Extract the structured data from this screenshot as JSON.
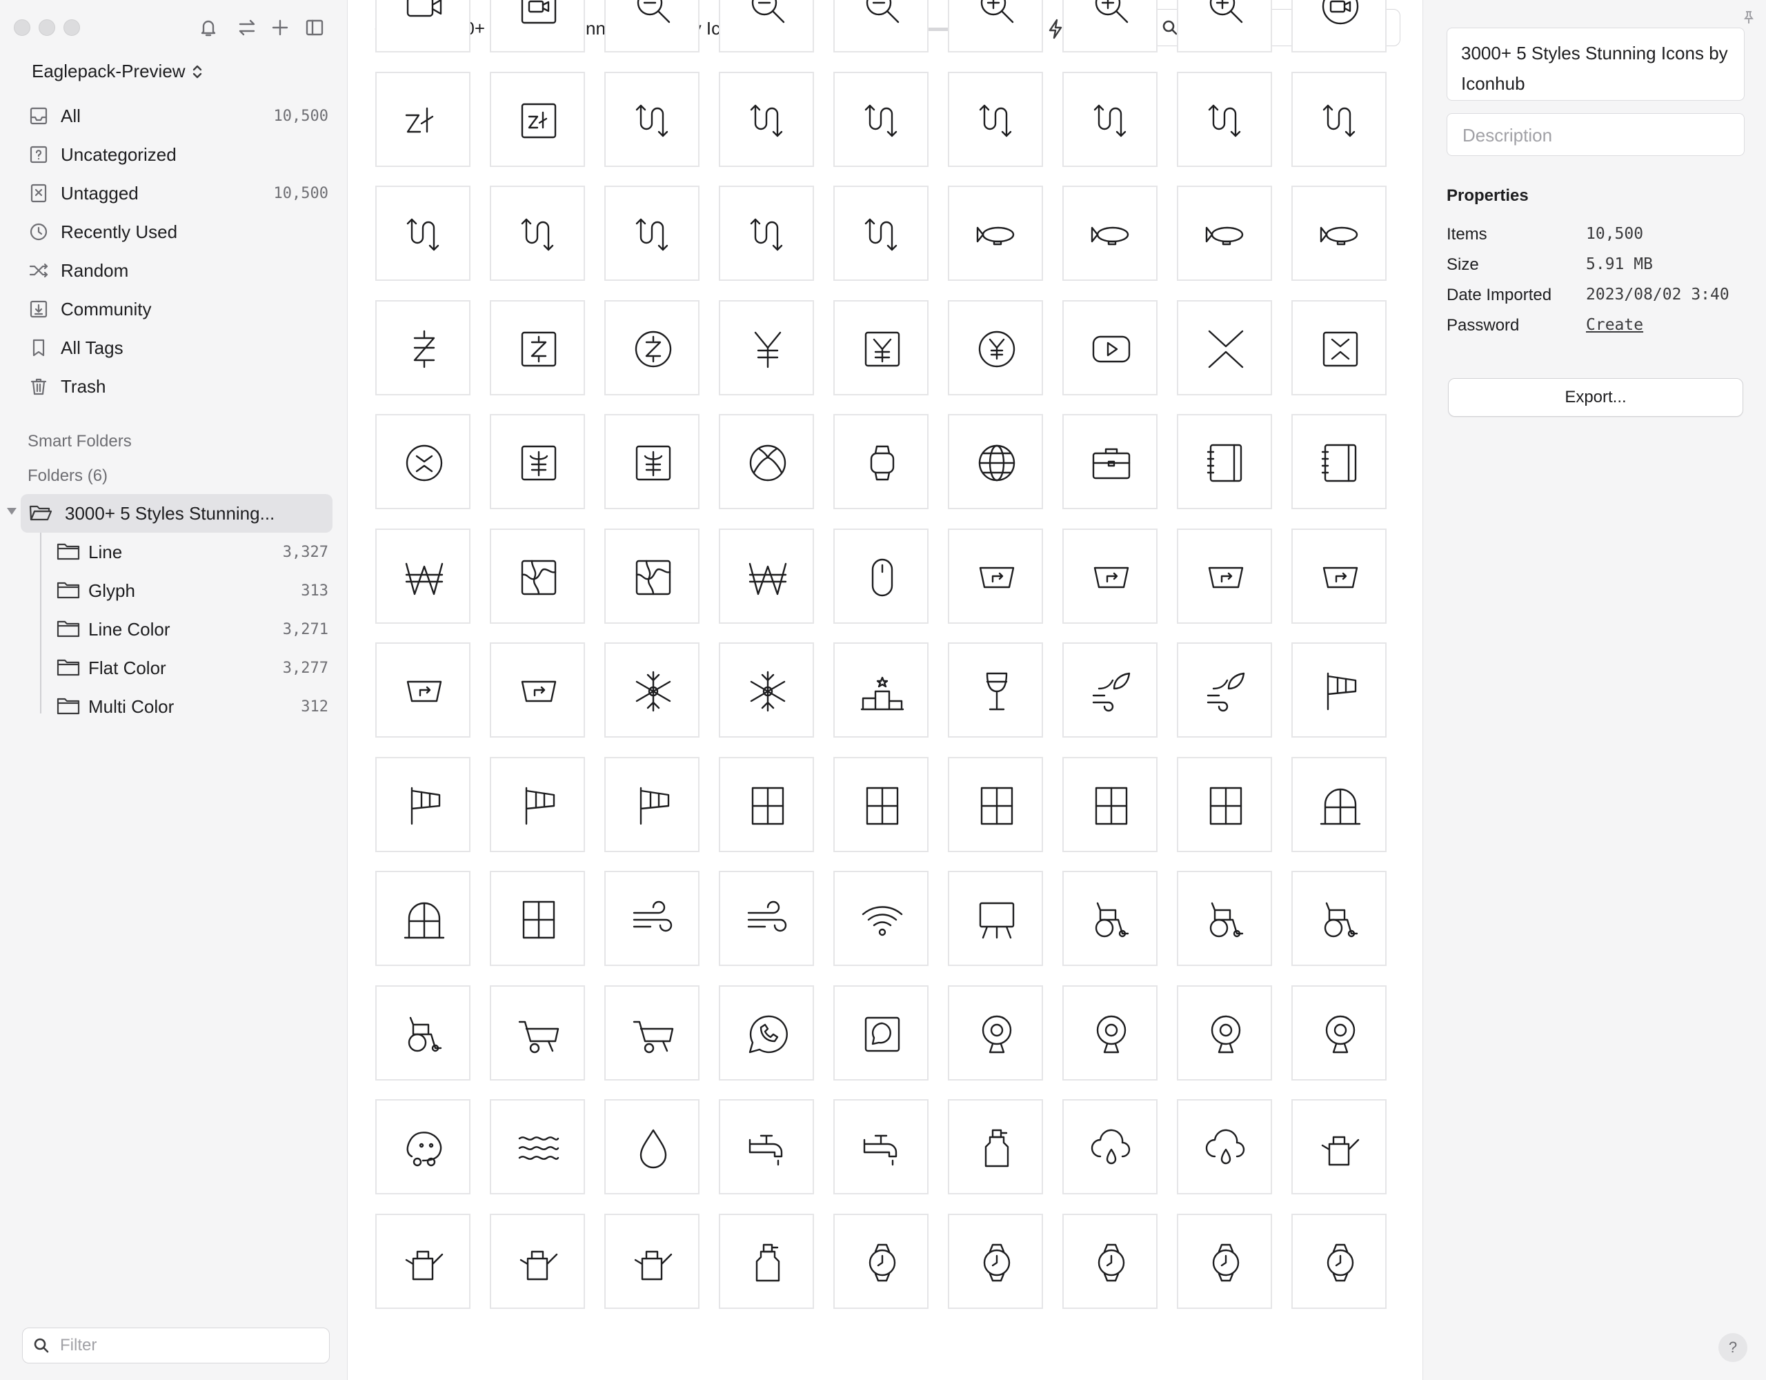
{
  "sidebar": {
    "library_name": "Eaglepack-Preview",
    "nav_items": [
      {
        "label": "All",
        "count": "10,500",
        "icon": "inbox-icon"
      },
      {
        "label": "Uncategorized",
        "count": "",
        "icon": "question-box-icon"
      },
      {
        "label": "Untagged",
        "count": "10,500",
        "icon": "untagged-icon"
      },
      {
        "label": "Recently Used",
        "count": "",
        "icon": "clock-icon"
      },
      {
        "label": "Random",
        "count": "",
        "icon": "shuffle-icon"
      },
      {
        "label": "Community",
        "count": "",
        "icon": "download-box-icon"
      },
      {
        "label": "All Tags",
        "count": "",
        "icon": "bookmark-icon"
      },
      {
        "label": "Trash",
        "count": "",
        "icon": "trash-icon"
      }
    ],
    "smart_folders_label": "Smart Folders",
    "folders_label": "Folders (6)",
    "root_folder": "3000+ 5 Styles Stunning...",
    "sub_folders": [
      {
        "label": "Line",
        "count": "3,327"
      },
      {
        "label": "Glyph",
        "count": "313"
      },
      {
        "label": "Line Color",
        "count": "3,271"
      },
      {
        "label": "Flat Color",
        "count": "3,277"
      },
      {
        "label": "Multi Color",
        "count": "312"
      }
    ],
    "filter_placeholder": "Filter"
  },
  "toolbar": {
    "title": "3000+ 5 Styles Stunning Icons by Iconhub",
    "search_placeholder": "Search",
    "zoom": 0
  },
  "grid": {
    "rows": [
      [
        "video-camera-icon",
        "video-box-icon",
        "zoom-out-icon",
        "zoom-out-icon",
        "zoom-out-icon",
        "zoom-in-icon",
        "zoom-in-icon",
        "zoom-in-icon",
        "video-circle-icon"
      ],
      [
        "zloty-icon",
        "zloty-box-icon",
        "zigzag-arrow-icon",
        "zigzag-arrow-icon",
        "zigzag-arrow-icon",
        "zigzag-arrow-icon",
        "zigzag-arrow-icon",
        "zigzag-arrow-icon",
        "zigzag-arrow-icon"
      ],
      [
        "zigzag-arrow-icon",
        "zigzag-arrow-icon",
        "zigzag-arrow-icon",
        "zigzag-arrow-icon",
        "zigzag-arrow-icon",
        "zeppelin-icon",
        "zeppelin-icon",
        "zeppelin-icon",
        "zeppelin-icon"
      ],
      [
        "zcash-icon",
        "zcash-box-icon",
        "zcash-circle-icon",
        "yuan-icon",
        "yuan-box-icon",
        "yuan-circle-icon",
        "youtube-icon",
        "x-chevrons-icon",
        "x-chevrons-box-icon"
      ],
      [
        "x-chevrons-circle-icon",
        "currency-box-icon",
        "currency-box-icon",
        "xbox-icon",
        "smartwatch-icon",
        "globe-icon",
        "briefcase-icon",
        "notebook-icon",
        "notebook-icon"
      ],
      [
        "won-icon",
        "map-icon",
        "map-icon",
        "won-icon",
        "mouse-icon",
        "windshield-icon",
        "windshield-icon",
        "windshield-icon",
        "windshield-icon"
      ],
      [
        "windshield-icon",
        "windshield-icon",
        "snowflake-icon",
        "snowflake-icon",
        "podium-icon",
        "wine-glass-icon",
        "wind-leaf-icon",
        "wind-leaf-icon",
        "windsock-icon"
      ],
      [
        "windsock-icon",
        "windsock-icon",
        "windsock-icon",
        "window-icon",
        "window-icon",
        "window-icon",
        "window-icon",
        "window-icon",
        "window-arch-icon"
      ],
      [
        "window-arch-icon",
        "window-icon",
        "wind-icon",
        "wind-icon",
        "wifi-icon",
        "easel-icon",
        "wheelchair-icon",
        "wheelchair-icon",
        "wheelchair-icon"
      ],
      [
        "wheelchair-icon",
        "wheelbarrow-icon",
        "wheelbarrow-icon",
        "whatsapp-icon",
        "chat-box-icon",
        "webcam-icon",
        "webcam-icon",
        "webcam-icon",
        "webcam-icon"
      ],
      [
        "waze-icon",
        "waves-icon",
        "drop-icon",
        "faucet-icon",
        "faucet-icon",
        "bottle-icon",
        "cloud-drop-icon",
        "cloud-drop-icon",
        "watering-can-icon"
      ],
      [
        "watering-can-icon",
        "watering-can-icon",
        "watering-can-icon",
        "bottle-icon",
        "watch-icon",
        "watch-icon",
        "watch-icon",
        "watch-icon",
        "watch-icon"
      ]
    ]
  },
  "inspector": {
    "name": "3000+ 5 Styles Stunning Icons by Iconhub",
    "description_placeholder": "Description",
    "properties_title": "Properties",
    "properties": [
      {
        "key": "Items",
        "value": "10,500"
      },
      {
        "key": "Size",
        "value": "5.91 MB"
      },
      {
        "key": "Date Imported",
        "value": "2023/08/02 3:40"
      },
      {
        "key": "Password",
        "value": "Create"
      }
    ],
    "export_label": "Export...",
    "help_label": "?"
  }
}
